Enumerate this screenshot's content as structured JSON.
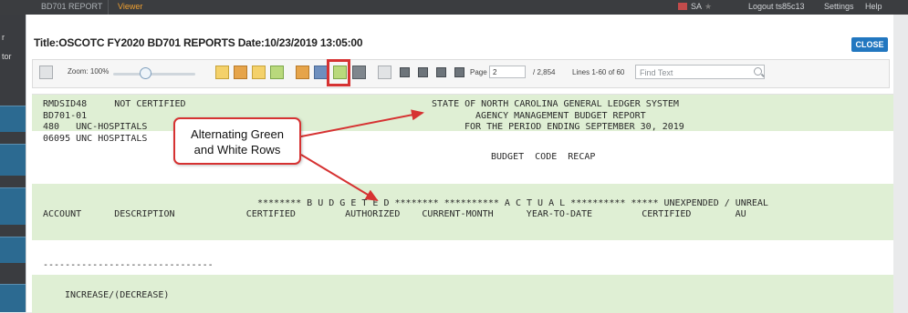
{
  "topbar": {
    "tab_report": "BD701 REPORT",
    "tab_viewer": "Viewer",
    "user": "SA",
    "logout": "Logout ts85c13",
    "settings": "Settings",
    "help": "Help"
  },
  "left_strip": {
    "label_1": "r",
    "label_2": "tor"
  },
  "dialog": {
    "title": "Title:OSCOTC FY2020 BD701 REPORTS Date:10/23/2019 13:05:00",
    "close_label": "CLOSE"
  },
  "toolbar": {
    "zoom_label": "Zoom: 100%",
    "zoom_percent": 100,
    "page_label": "Page",
    "page_value": "2",
    "page_total": "/ 2,854",
    "lines_label": "Lines 1-60 of 60",
    "find_placeholder": "Find Text"
  },
  "report_lines": {
    "l1a": "RMDSID48     NOT CERTIFIED",
    "l1b": "STATE OF NORTH CAROLINA GENERAL LEDGER SYSTEM",
    "l2a": "BD701-01",
    "l2b": "AGENCY MANAGEMENT BUDGET REPORT",
    "l3a": "480   UNC-HOSPITALS",
    "l3b": "FOR THE PERIOD ENDING SEPTEMBER 30, 2019",
    "l4a": "06095 UNC HOSPITALS",
    "l5": "BUDGET  CODE  RECAP",
    "l6": "******** B U D G E T E D ******** ********** A C T U A L ********** ***** UNEXPENDED / UNREAL",
    "l7": "ACCOUNT      DESCRIPTION             CERTIFIED         AUTHORIZED    CURRENT-MONTH      YEAR-TO-DATE         CERTIFIED        AU",
    "l8": "-------------------------------",
    "l9": "INCREASE/(DECREASE)"
  },
  "annotation": {
    "line1": "Alternating Green",
    "line2": "and White Rows"
  },
  "colors": {
    "green_row": "#dfefd4",
    "highlight_red": "#d63232",
    "close_blue": "#2277c0"
  }
}
